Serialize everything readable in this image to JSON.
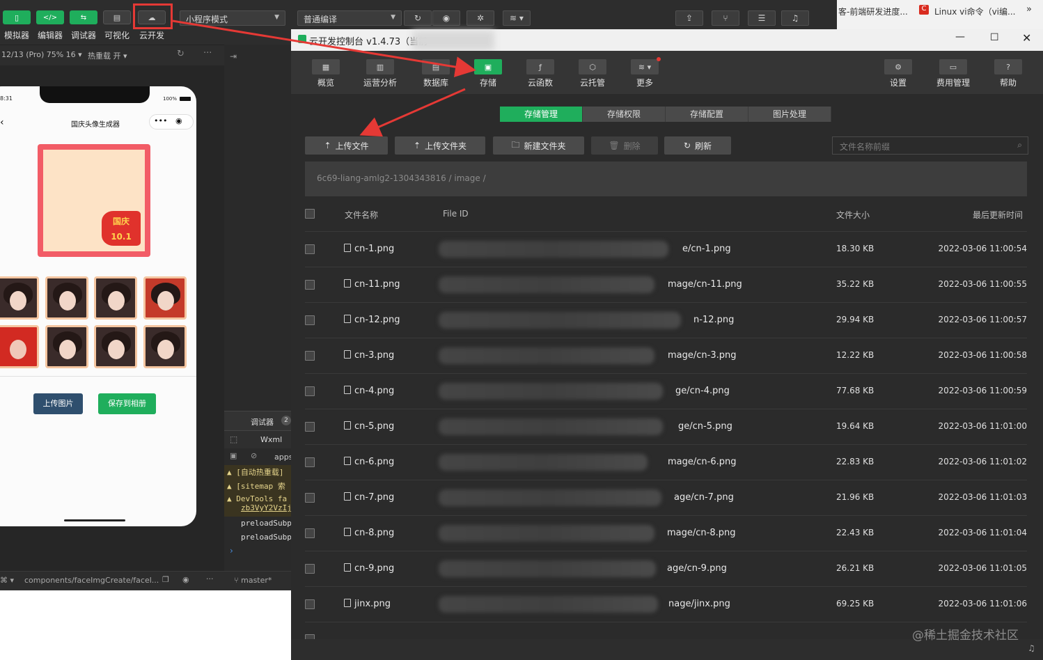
{
  "toolbar": {
    "buttons": [
      {
        "label": "模拟器",
        "icon": "phone-icon"
      },
      {
        "label": "编辑器",
        "icon": "code-icon"
      },
      {
        "label": "调试器",
        "icon": "debug-icon"
      },
      {
        "label": "可视化",
        "icon": "layout-icon"
      },
      {
        "label": "云开发",
        "icon": "cloud-icon"
      }
    ],
    "mode_select": "小程序模式",
    "compile_select": "普通编译"
  },
  "browser_tabs": [
    "客-前端研发进度...",
    "Linux vi命令（vi编..."
  ],
  "simulator": {
    "device_info": "12/13 (Pro) 75% 16",
    "hot_reload": "热重载 开",
    "status_time": "8:31",
    "battery": "100%",
    "page_title": "国庆头像生成器",
    "frame_badge": "国庆 10.1",
    "upload_btn": "上传图片",
    "save_btn": "保存到相册"
  },
  "devtools": {
    "tab": "调试器",
    "tab_count": "2",
    "wxml": "Wxml",
    "apps": "apps",
    "logs": [
      "[自动热重载]",
      "[sitemap 索",
      "DevTools fa",
      "zb3VyY2VzIj",
      "preloadSubp",
      "preloadSubp"
    ]
  },
  "statusbar": {
    "path": "components/faceImgCreate/facel...",
    "branch": "master*"
  },
  "cloud": {
    "title": "云开发控制台 v1.4.73（当前",
    "nav": [
      {
        "label": "概览",
        "icon": "grid-icon"
      },
      {
        "label": "运营分析",
        "icon": "bar-chart-icon"
      },
      {
        "label": "数据库",
        "icon": "database-icon"
      },
      {
        "label": "存储",
        "icon": "storage-icon"
      },
      {
        "label": "云函数",
        "icon": "function-icon"
      },
      {
        "label": "云托管",
        "icon": "box-icon"
      },
      {
        "label": "更多",
        "icon": "layers-icon"
      }
    ],
    "nav_right": [
      {
        "label": "设置",
        "icon": "gear-icon"
      },
      {
        "label": "费用管理",
        "icon": "wallet-icon"
      },
      {
        "label": "帮助",
        "icon": "help-icon"
      }
    ],
    "subtabs": [
      "存储管理",
      "存储权限",
      "存储配置",
      "图片处理"
    ],
    "actions": {
      "upload_file": "上传文件",
      "upload_folder": "上传文件夹",
      "new_folder": "新建文件夹",
      "delete": "删除",
      "refresh": "刷新"
    },
    "search_placeholder": "文件名称前缀",
    "breadcrumb": "6c69-liang-amlg2-1304343816 / image /",
    "columns": {
      "name": "文件名称",
      "file_id": "File ID",
      "size": "文件大小",
      "updated": "最后更新时间"
    },
    "files": [
      {
        "name": "cn-1.png",
        "fid": "e/cn-1.png",
        "size": "18.30 KB",
        "time": "2022-03-06 11:00:54"
      },
      {
        "name": "cn-11.png",
        "fid": "mage/cn-11.png",
        "size": "35.22 KB",
        "time": "2022-03-06 11:00:55"
      },
      {
        "name": "cn-12.png",
        "fid": "n-12.png",
        "size": "29.94 KB",
        "time": "2022-03-06 11:00:57"
      },
      {
        "name": "cn-3.png",
        "fid": "mage/cn-3.png",
        "size": "12.22 KB",
        "time": "2022-03-06 11:00:58"
      },
      {
        "name": "cn-4.png",
        "fid": "ge/cn-4.png",
        "size": "77.68 KB",
        "time": "2022-03-06 11:00:59"
      },
      {
        "name": "cn-5.png",
        "fid": "ge/cn-5.png",
        "size": "19.64 KB",
        "time": "2022-03-06 11:01:00"
      },
      {
        "name": "cn-6.png",
        "fid": "mage/cn-6.png",
        "size": "22.83 KB",
        "time": "2022-03-06 11:01:02"
      },
      {
        "name": "cn-7.png",
        "fid": "age/cn-7.png",
        "size": "21.96 KB",
        "time": "2022-03-06 11:01:03"
      },
      {
        "name": "cn-8.png",
        "fid": "mage/cn-8.png",
        "size": "22.43 KB",
        "time": "2022-03-06 11:01:04"
      },
      {
        "name": "cn-9.png",
        "fid": "age/cn-9.png",
        "size": "26.21 KB",
        "time": "2022-03-06 11:01:05"
      },
      {
        "name": "jinx.png",
        "fid": "nage/jinx.png",
        "size": "69.25 KB",
        "time": "2022-03-06 11:01:06"
      }
    ]
  },
  "watermark": "@稀土掘金技术社区",
  "colors": {
    "accent": "#1fae5c",
    "annotation": "#e53935",
    "panel": "#2b2b2b"
  }
}
